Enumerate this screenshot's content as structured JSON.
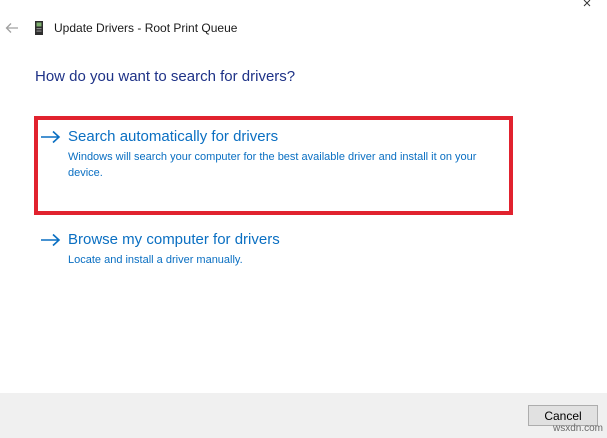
{
  "window": {
    "title": "Update Drivers - Root Print Queue",
    "back_icon": "back-arrow-icon",
    "device_icon": "printer-device-icon"
  },
  "question": "How do you want to search for drivers?",
  "options": [
    {
      "title": "Search automatically for drivers",
      "description": "Windows will search your computer for the best available driver and install it on your device.",
      "icon": "right-arrow-icon",
      "highlighted": true
    },
    {
      "title": "Browse my computer for drivers",
      "description": "Locate and install a driver manually.",
      "icon": "right-arrow-icon",
      "highlighted": false
    }
  ],
  "footer": {
    "cancel_label": "Cancel"
  },
  "watermark": "wsxdn.com",
  "colors": {
    "heading": "#1e3287",
    "link": "#0a6fc2",
    "highlight_border": "#e1222e",
    "footer_bg": "#f0f0f0"
  }
}
